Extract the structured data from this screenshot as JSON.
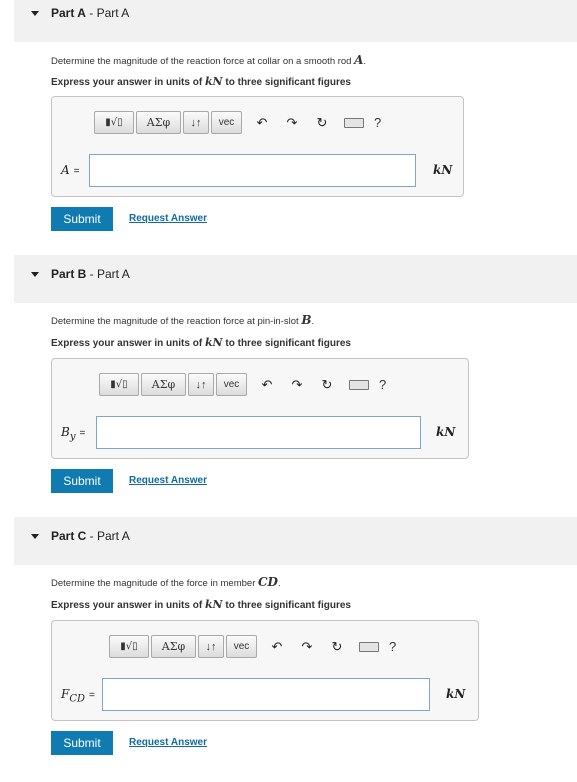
{
  "parts": [
    {
      "label": "Part A",
      "subtitle": " - Part A",
      "question_text": "Determine the magnitude of the reaction force at collar on a smooth rod ",
      "question_var": "A",
      "question_end": ".",
      "instruction_pre": "Express your answer in units of ",
      "instruction_unit": "kN",
      "instruction_post": " to three significant figures",
      "answer_var": "A",
      "answer_sub": "",
      "answer_value": "",
      "unit": "kN",
      "submit_label": "Submit",
      "request_label": "Request Answer"
    },
    {
      "label": "Part B",
      "subtitle": " - Part A",
      "question_text": "Determine the magnitude of the reaction force at pin-in-slot ",
      "question_var": "B",
      "question_end": ".",
      "instruction_pre": "Express your answer in units of ",
      "instruction_unit": "kN",
      "instruction_post": " to three significant figures",
      "answer_var": "B",
      "answer_sub": "y",
      "answer_value": "",
      "unit": "kN",
      "submit_label": "Submit",
      "request_label": "Request Answer"
    },
    {
      "label": "Part C",
      "subtitle": " - Part A",
      "question_text": "Determine the magnitude of the force in member ",
      "question_var": "CD",
      "question_end": ".",
      "instruction_pre": "Express your answer in units of ",
      "instruction_unit": "kN",
      "instruction_post": " to three significant figures",
      "answer_var": "F",
      "answer_sub": "CD",
      "answer_value": "",
      "unit": "kN",
      "submit_label": "Submit",
      "request_label": "Request Answer"
    }
  ],
  "toolbar": {
    "templates_label": "▮√▯",
    "greek_label": "ΑΣφ",
    "arrows_label": "↓↑",
    "vec_label": "vec",
    "undo_icon": "undo-icon",
    "redo_icon": "redo-icon",
    "reset_icon": "reset-icon",
    "keyboard_icon": "keyboard-icon",
    "help_label": "?"
  },
  "equals": "="
}
